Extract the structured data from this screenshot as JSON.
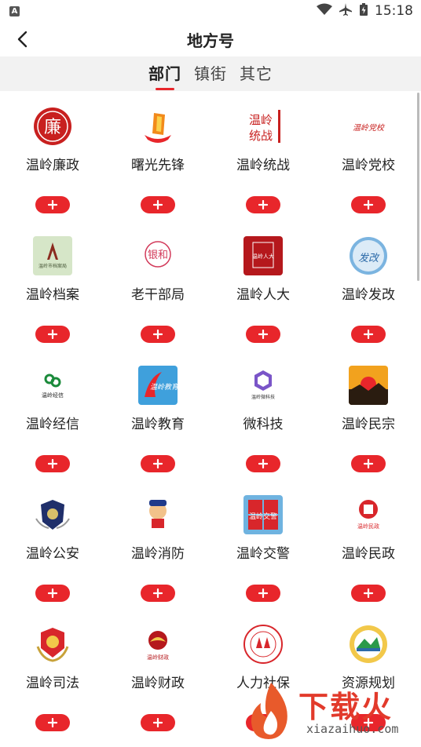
{
  "status": {
    "time": "15:18",
    "badge": "A"
  },
  "nav": {
    "title": "地方号"
  },
  "tabs": [
    {
      "label": "部门",
      "active": true
    },
    {
      "label": "镇街",
      "active": false
    },
    {
      "label": "其它",
      "active": false
    }
  ],
  "accent": "#e8262b",
  "items": [
    {
      "name": "温岭廉政",
      "icon": "lianzheng-logo",
      "logo_text": "廉"
    },
    {
      "name": "曙光先锋",
      "icon": "shuguang-logo",
      "logo_text": ""
    },
    {
      "name": "温岭统战",
      "icon": "tongzhan-logo",
      "logo_text": "温岭\n统战"
    },
    {
      "name": "温岭党校",
      "icon": "dangxiao-logo",
      "logo_text": "温岭党校"
    },
    {
      "name": "温岭档案",
      "icon": "dangan-logo",
      "logo_text": "温岭市档案局"
    },
    {
      "name": "老干部局",
      "icon": "laoganbu-logo",
      "logo_text": "银和"
    },
    {
      "name": "温岭人大",
      "icon": "renda-logo",
      "logo_text": "温岭人大"
    },
    {
      "name": "温岭发改",
      "icon": "fagai-logo",
      "logo_text": "发改"
    },
    {
      "name": "温岭经信",
      "icon": "jingxin-logo",
      "logo_text": "温岭经信"
    },
    {
      "name": "温岭教育",
      "icon": "jiaoyu-logo",
      "logo_text": "温岭教育"
    },
    {
      "name": "微科技",
      "icon": "weikeji-logo",
      "logo_text": "温岭微科技"
    },
    {
      "name": "温岭民宗",
      "icon": "minzong-logo",
      "logo_text": ""
    },
    {
      "name": "温岭公安",
      "icon": "gongan-logo",
      "logo_text": ""
    },
    {
      "name": "温岭消防",
      "icon": "xiaofang-logo",
      "logo_text": ""
    },
    {
      "name": "温岭交警",
      "icon": "jiaojing-logo",
      "logo_text": "温岭交警"
    },
    {
      "name": "温岭民政",
      "icon": "minzheng-logo",
      "logo_text": "温岭民政"
    },
    {
      "name": "温岭司法",
      "icon": "sifa-logo",
      "logo_text": ""
    },
    {
      "name": "温岭财政",
      "icon": "caizheng-logo",
      "logo_text": "温岭财政"
    },
    {
      "name": "人力社保",
      "icon": "shebao-logo",
      "logo_text": ""
    },
    {
      "name": "资源规划",
      "icon": "guihua-logo",
      "logo_text": ""
    }
  ],
  "watermark": {
    "text": "下载火",
    "url": "xiazaihuo.com"
  }
}
